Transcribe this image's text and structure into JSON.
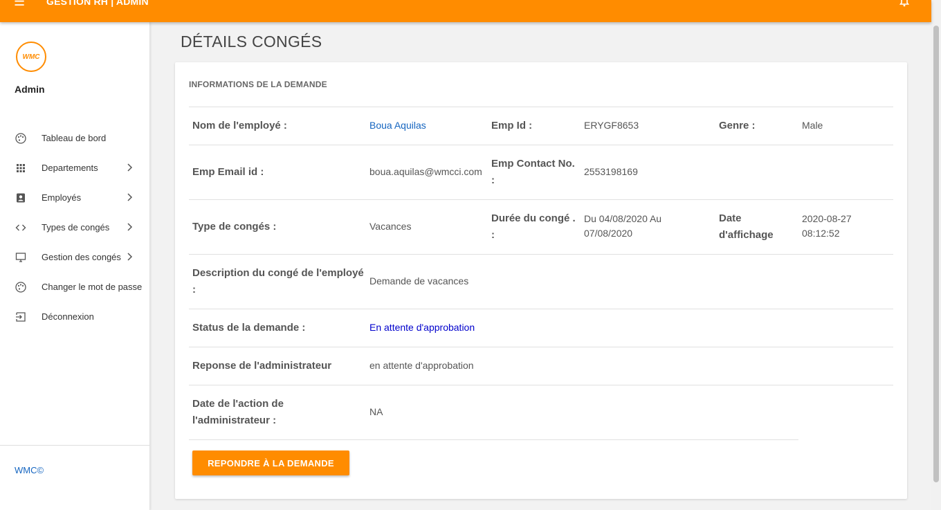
{
  "header": {
    "title": "GESTION RH | ADMIN",
    "menu_icon": "menu-icon",
    "bell_icon": "bell-icon",
    "color": "#ff8c00"
  },
  "sidebar": {
    "logo_text": "WMC",
    "user": "Admin",
    "items": [
      {
        "label": "Tableau de bord",
        "icon": "dashboard-icon",
        "has_submenu": false
      },
      {
        "label": "Departements",
        "icon": "grid-icon",
        "has_submenu": true
      },
      {
        "label": "Employés",
        "icon": "contact-card-icon",
        "has_submenu": true
      },
      {
        "label": "Types de congés",
        "icon": "code-icon",
        "has_submenu": true
      },
      {
        "label": "Gestion des congés",
        "icon": "monitor-icon",
        "has_submenu": true
      },
      {
        "label": "Changer le mot de passe",
        "icon": "palette-icon",
        "has_submenu": false
      },
      {
        "label": "Déconnexion",
        "icon": "logout-icon",
        "has_submenu": false
      }
    ],
    "footer": "WMC©"
  },
  "page": {
    "title": "DÉTAILS CONGÉS"
  },
  "card": {
    "heading": "INFORMATIONS DE LA DEMANDE",
    "employee_name_label": "Nom de l'employé :",
    "employee_name": "Boua Aquilas",
    "emp_id_label": "Emp Id :",
    "emp_id": "ERYGF8653",
    "gender_label": "Genre :",
    "gender": "Male",
    "email_label": "Emp Email id :",
    "email": "boua.aquilas@wmcci.com",
    "contact_label_1": "Emp Contact No.",
    "contact_label_2": ":",
    "contact": "2553198169",
    "leave_type_label": "Type de congés :",
    "leave_type": "Vacances",
    "duration_label_1": "Durée du congé .",
    "duration_label_2": ":",
    "duration_1": "Du 04/08/2020 Au",
    "duration_2": "07/08/2020",
    "posting_date_label_1": "Date",
    "posting_date_label_2": "d'affichage",
    "posting_date_1": "2020-08-27",
    "posting_date_2": "08:12:52",
    "description_label_1": "Description du congé de l'employé",
    "description_label_2": ":",
    "description": "Demande de vacances",
    "status_label": "Status de la demande :",
    "status": "En attente d'approbation",
    "admin_response_label": "Reponse de l'administrateur",
    "admin_response": "en attente d'approbation",
    "admin_action_date_label_1": "Date de l'action de",
    "admin_action_date_label_2": "l'administrateur :",
    "admin_action_date": "NA",
    "action_button": "REPONDRE À LA DEMANDE"
  }
}
